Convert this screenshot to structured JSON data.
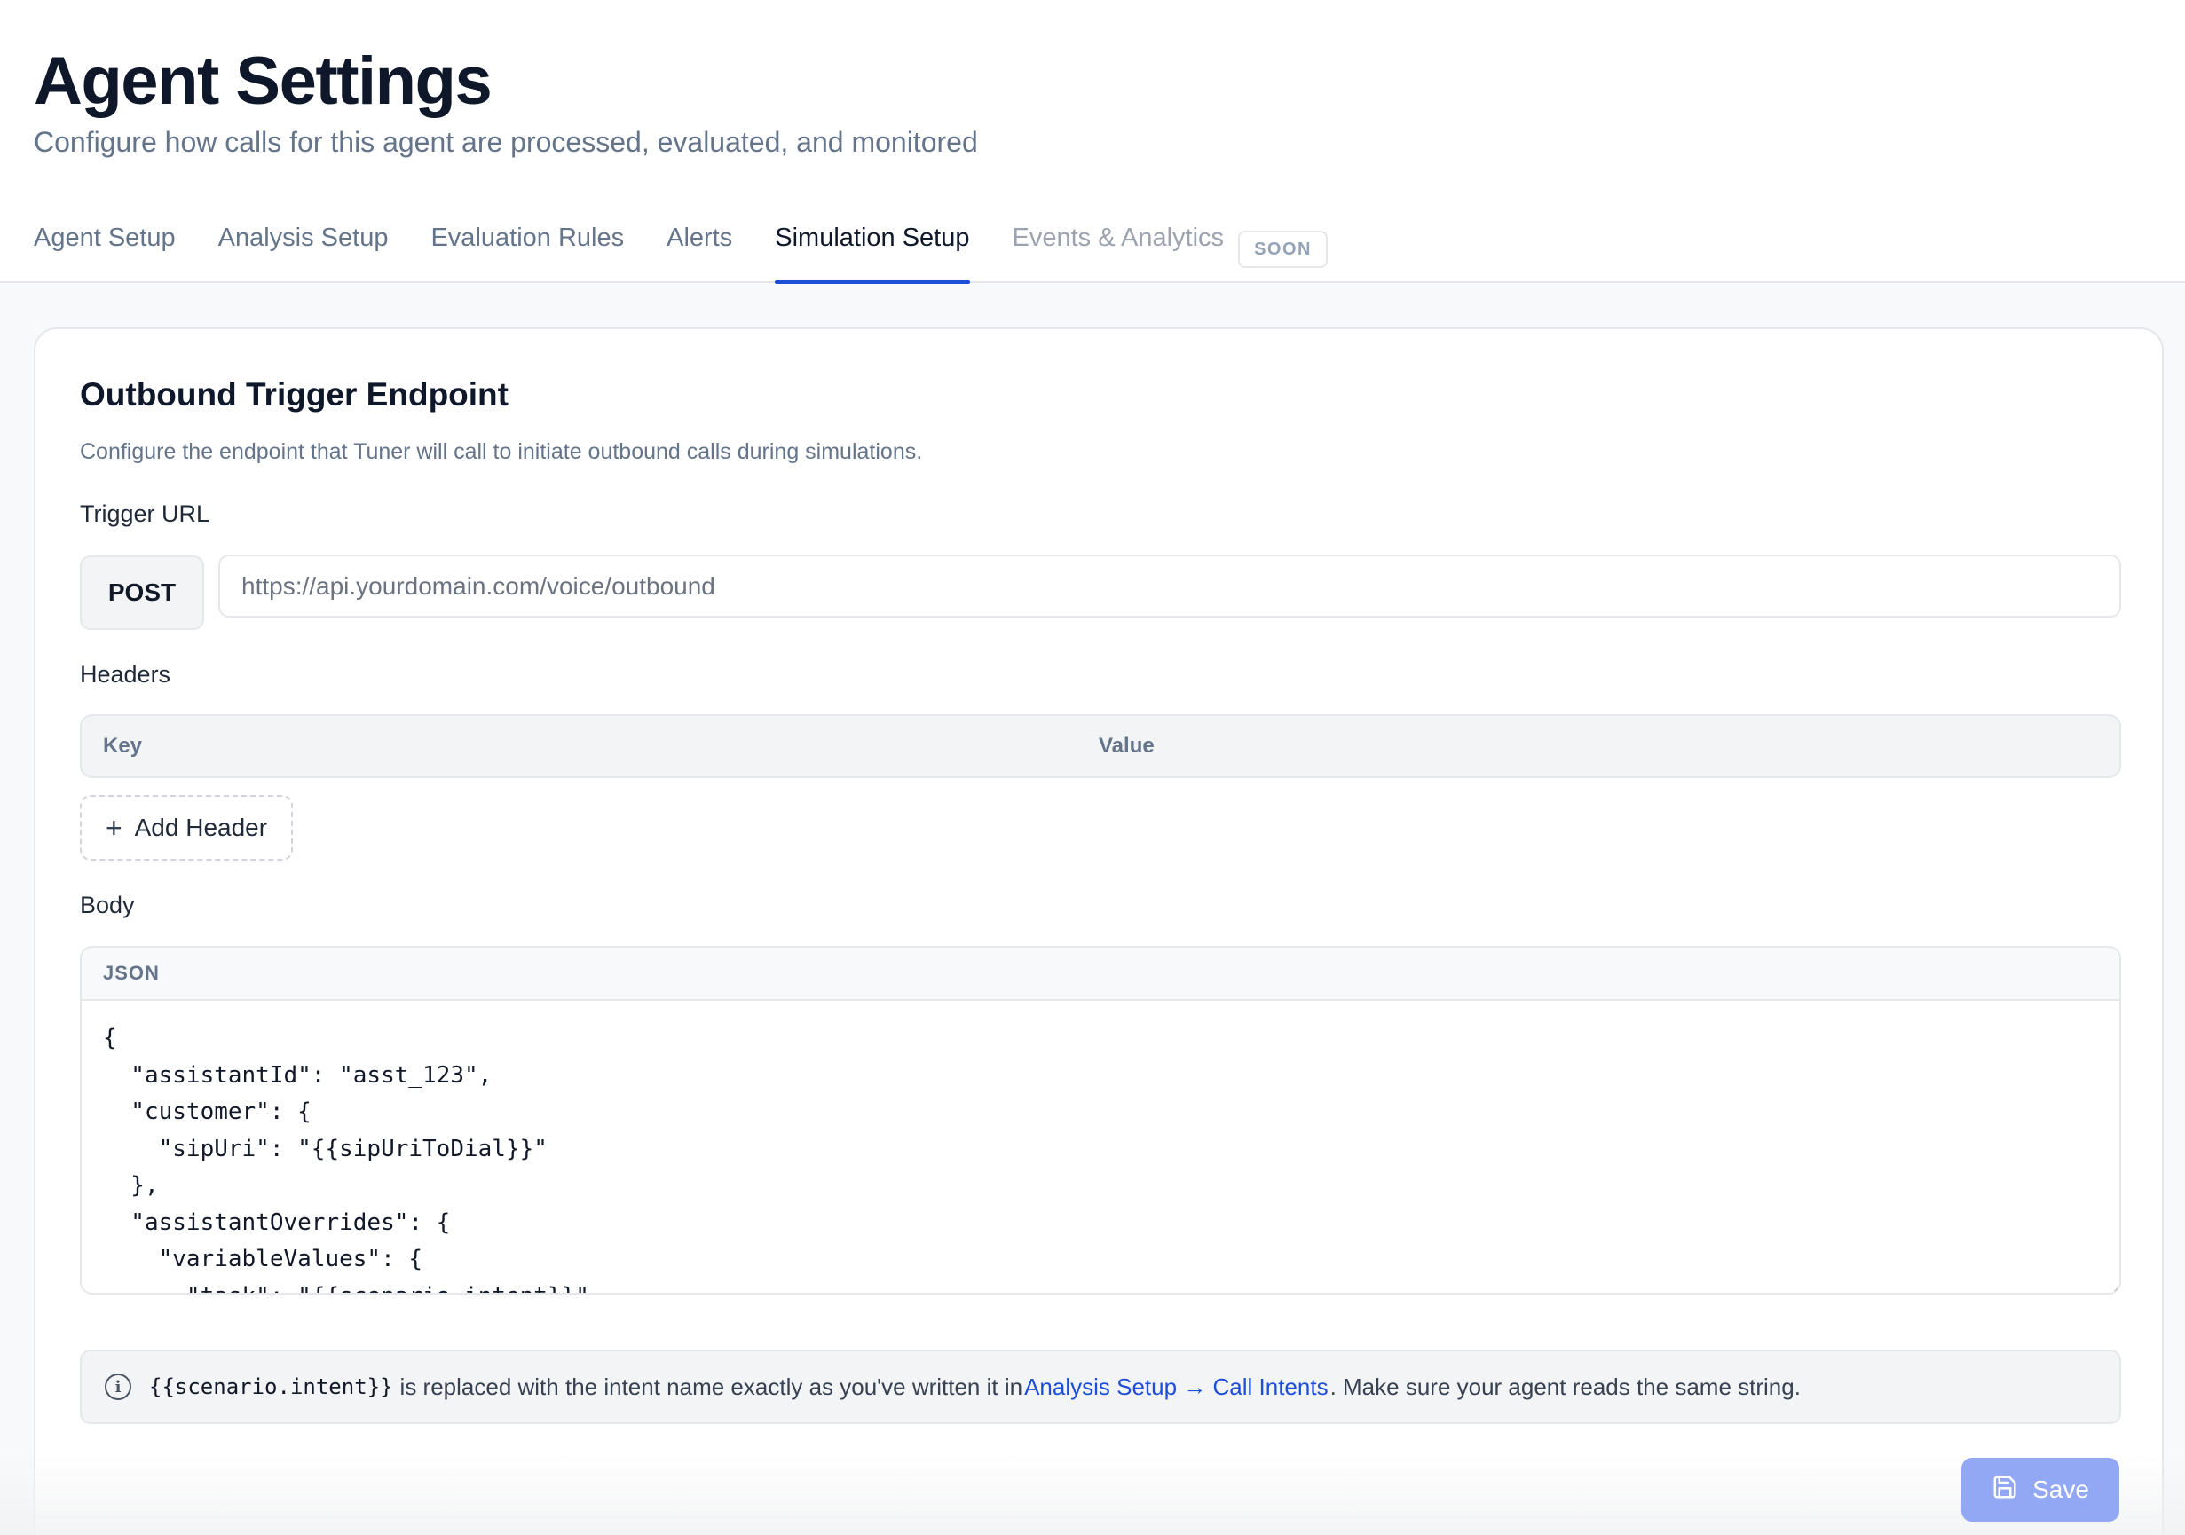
{
  "page": {
    "title": "Agent Settings",
    "subtitle": "Configure how calls for this agent are processed, evaluated, and monitored"
  },
  "tabs": [
    {
      "label": "Agent Setup",
      "active": false
    },
    {
      "label": "Analysis Setup",
      "active": false
    },
    {
      "label": "Evaluation Rules",
      "active": false
    },
    {
      "label": "Alerts",
      "active": false
    },
    {
      "label": "Simulation Setup",
      "active": true
    },
    {
      "label": "Events & Analytics",
      "active": false,
      "disabled": true,
      "badge": "SOON"
    }
  ],
  "section": {
    "title": "Outbound Trigger Endpoint",
    "description": "Configure the endpoint that Tuner will call to initiate outbound calls during simulations."
  },
  "trigger": {
    "label": "Trigger URL",
    "method": "POST",
    "url_placeholder": "https://api.yourdomain.com/voice/outbound"
  },
  "headers": {
    "label": "Headers",
    "columns": {
      "key": "Key",
      "value": "Value"
    },
    "add_label": "Add Header",
    "add_icon": "plus-icon"
  },
  "body": {
    "label": "Body",
    "format": "JSON",
    "content": "{\n  \"assistantId\": \"asst_123\",\n  \"customer\": {\n    \"sipUri\": \"{{sipUriToDial}}\"\n  },\n  \"assistantOverrides\": {\n    \"variableValues\": {\n      \"task\": \"{{scenario.intent}}\","
  },
  "info": {
    "icon": "info-icon",
    "code": "{{scenario.intent}}",
    "text_before": "is replaced with the intent name exactly as you've written it in",
    "link_text": "Analysis Setup → Call Intents",
    "text_after": ". Make sure your agent reads the same string."
  },
  "actions": {
    "save_label": "Save",
    "save_icon": "save-icon"
  },
  "colors": {
    "accent": "#1d4ed8",
    "save_button": "#93a8f5"
  }
}
